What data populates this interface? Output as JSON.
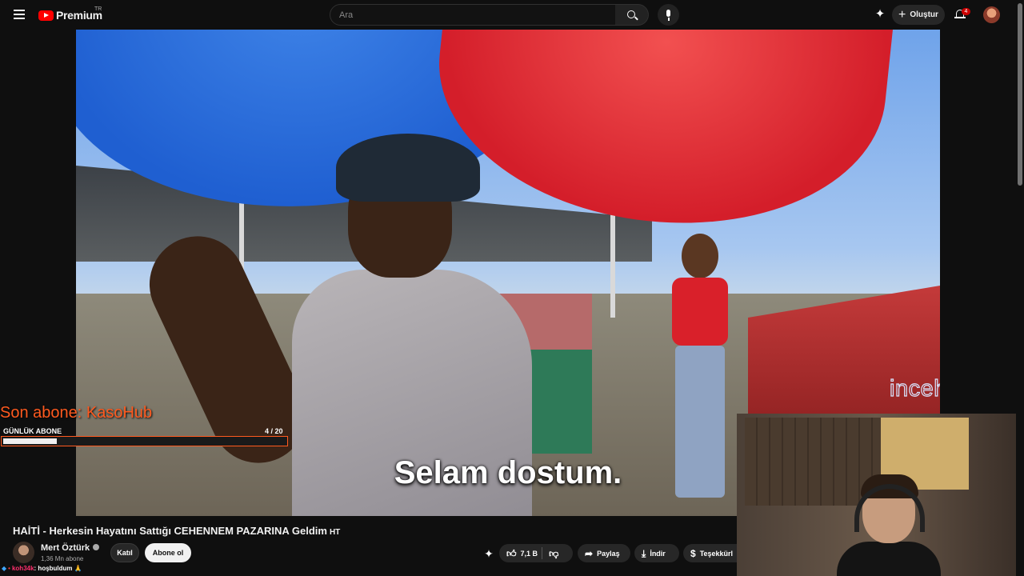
{
  "header": {
    "logo_text": "Premium",
    "country_code": "TR",
    "search_placeholder": "Ara",
    "create_label": "Oluştur",
    "notification_count": "4"
  },
  "player": {
    "subtitle": "Selam dostum.",
    "watermark": "incehesap"
  },
  "stream_overlay": {
    "last_subscriber": "Son abone: KasoHub",
    "goal_label": "GÜNLÜK ABONE",
    "goal_count": "4 / 20",
    "goal_progress": 0.2
  },
  "video": {
    "title": "HAİTİ - Herkesin Hayatını Sattığı CEHENNEM PAZARINA Geldim",
    "title_tag": "HT",
    "channel_name": "Mert Öztürk",
    "subscribers": "1,36 Mn abone",
    "join_label": "Katıl",
    "subscribe_label": "Abone ol",
    "likes": "7,1 B",
    "share_label": "Paylaş",
    "download_label": "İndir",
    "thanks_label": "Teşekkürl"
  },
  "chat": {
    "user": "koh34k",
    "message": ": hoşbuldum",
    "emoji": "🙏"
  },
  "icons": [
    "menu-icon",
    "youtube-logo-icon",
    "search-icon",
    "mic-icon",
    "sparkle-icon",
    "plus-icon",
    "bell-icon",
    "like-icon",
    "dislike-icon",
    "share-icon",
    "download-icon",
    "thanks-icon",
    "verified-icon"
  ],
  "colors": {
    "brand_red": "#ff0000",
    "overlay_orange": "#ff5a1f",
    "background": "#0f0f0f"
  }
}
